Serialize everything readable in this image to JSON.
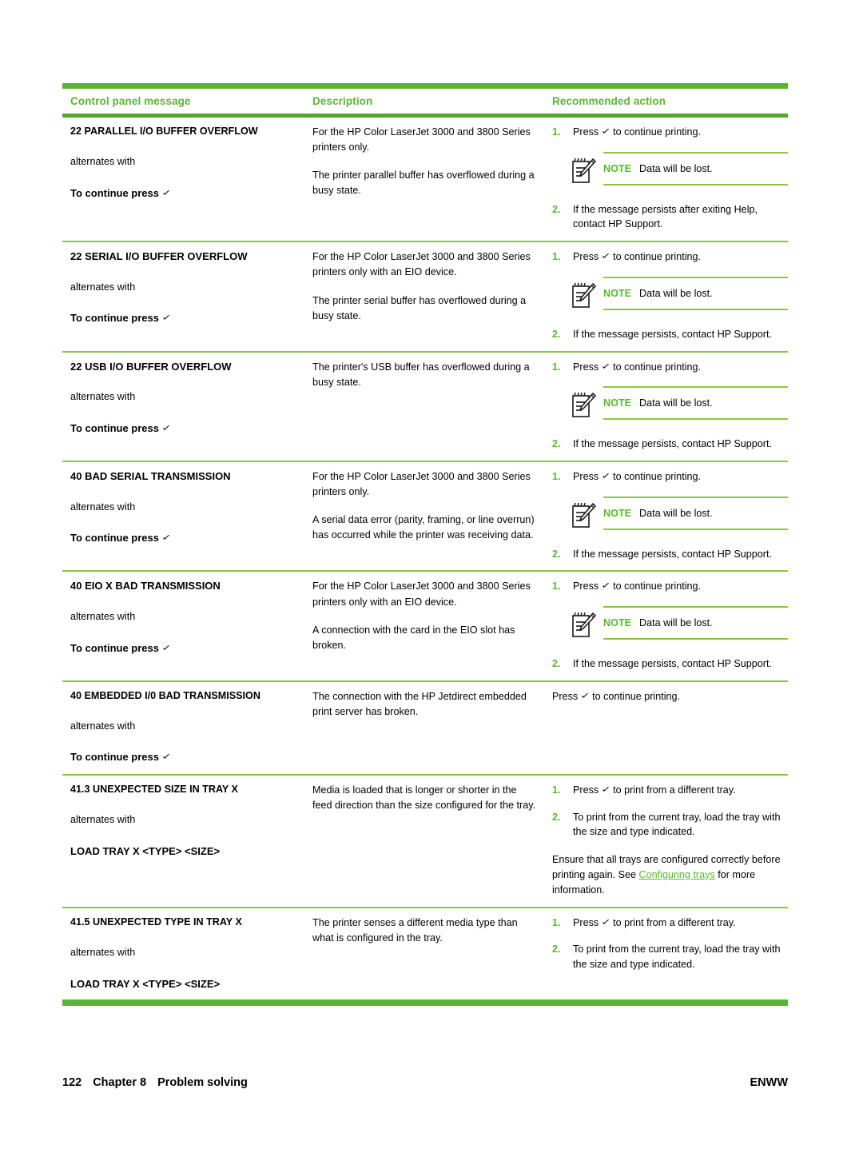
{
  "table": {
    "headers": [
      "Control panel message",
      "Description",
      "Recommended action"
    ],
    "rows": [
      {
        "message": "22 PARALLEL I/O BUFFER OVERFLOW",
        "alternates_label": "alternates with",
        "alternate_message": "To continue press",
        "description": [
          "For the HP Color LaserJet 3000 and 3800 Series printers only.",
          "The printer parallel buffer has overflowed during a busy state."
        ],
        "steps": [
          {
            "num": "1.",
            "text": "Press ✓ to continue printing."
          },
          {
            "num": "2.",
            "text": "If the message persists after exiting Help, contact HP Support."
          }
        ],
        "note": {
          "label": "NOTE",
          "text": "Data will be lost."
        },
        "note_after_step": 1
      },
      {
        "message": "22 SERIAL I/O BUFFER OVERFLOW",
        "alternates_label": "alternates with",
        "alternate_message": "To continue press",
        "description": [
          "For the HP Color LaserJet 3000 and 3800 Series printers only with an EIO device.",
          "The printer serial buffer has overflowed during a busy state."
        ],
        "steps": [
          {
            "num": "1.",
            "text": "Press ✓ to continue printing."
          },
          {
            "num": "2.",
            "text": "If the message persists, contact HP Support."
          }
        ],
        "note": {
          "label": "NOTE",
          "text": "Data will be lost."
        },
        "note_after_step": 1
      },
      {
        "message": "22 USB I/O BUFFER OVERFLOW",
        "alternates_label": "alternates with",
        "alternate_message": "To continue press",
        "description": [
          "The printer's USB buffer has overflowed during a busy state."
        ],
        "steps": [
          {
            "num": "1.",
            "text": "Press ✓ to continue printing."
          },
          {
            "num": "2.",
            "text": "If the message persists, contact HP Support."
          }
        ],
        "note": {
          "label": "NOTE",
          "text": "Data will be lost."
        },
        "note_after_step": 1
      },
      {
        "message": "40 BAD SERIAL TRANSMISSION",
        "alternates_label": "alternates with",
        "alternate_message": "To continue press",
        "description": [
          "For the HP Color LaserJet 3000 and 3800 Series printers only.",
          "A serial data error (parity, framing, or line overrun) has occurred while the printer was receiving data."
        ],
        "steps": [
          {
            "num": "1.",
            "text": "Press ✓ to continue printing."
          },
          {
            "num": "2.",
            "text": "If the message persists, contact HP Support."
          }
        ],
        "note": {
          "label": "NOTE",
          "text": "Data will be lost."
        },
        "note_after_step": 1
      },
      {
        "message": "40 EIO X BAD TRANSMISSION",
        "alternates_label": "alternates with",
        "alternate_message": "To continue press",
        "description": [
          "For the HP Color LaserJet 3000 and 3800 Series printers only with an EIO device.",
          "A connection with the card in the EIO slot has broken."
        ],
        "steps": [
          {
            "num": "1.",
            "text": "Press ✓ to continue printing."
          },
          {
            "num": "2.",
            "text": "If the message persists, contact HP Support."
          }
        ],
        "note": {
          "label": "NOTE",
          "text": "Data will be lost."
        },
        "note_after_step": 1
      },
      {
        "message": "40 EMBEDDED I/0 BAD TRANSMISSION",
        "alternates_label": "alternates with",
        "alternate_message": "To continue press",
        "description": [
          "The connection with the HP Jetdirect embedded print server has broken."
        ],
        "plain_action": "Press ✓ to continue printing."
      },
      {
        "message": "41.3 UNEXPECTED SIZE IN TRAY X",
        "alternates_label": "alternates with",
        "alternate_message": "LOAD TRAY X <TYPE> <SIZE>",
        "alternate_no_check": true,
        "description": [
          "Media is loaded that is longer or shorter in the feed direction than the size configured for the tray."
        ],
        "steps": [
          {
            "num": "1.",
            "text": "Press ✓ to print from a different tray."
          },
          {
            "num": "2.",
            "text": "To print from the current tray, load the tray with the size and type indicated."
          }
        ],
        "extra_note": {
          "before": "Ensure that all trays are configured correctly before printing again. See ",
          "link": "Configuring trays",
          "after": " for more information."
        }
      },
      {
        "message": "41.5 UNEXPECTED TYPE IN TRAY X",
        "alternates_label": "alternates with",
        "alternate_message": "LOAD TRAY X <TYPE> <SIZE>",
        "alternate_no_check": true,
        "description": [
          "The printer senses a different media type than what is configured in the tray."
        ],
        "steps": [
          {
            "num": "1.",
            "text": "Press ✓ to print from a different tray."
          },
          {
            "num": "2.",
            "text": "To print from the current tray, load the tray with the size and type indicated."
          }
        ]
      }
    ]
  },
  "footer": {
    "page_number": "122",
    "chapter": "Chapter 8",
    "chapter_title": "Problem solving",
    "locale": "ENWW"
  },
  "colors": {
    "brand_green": "#5cb531",
    "rule_green": "#8cc63f",
    "link_green": "#5cb531"
  },
  "icons": {
    "note": "notepad-pencil-icon",
    "check": "checkmark-glyph"
  }
}
